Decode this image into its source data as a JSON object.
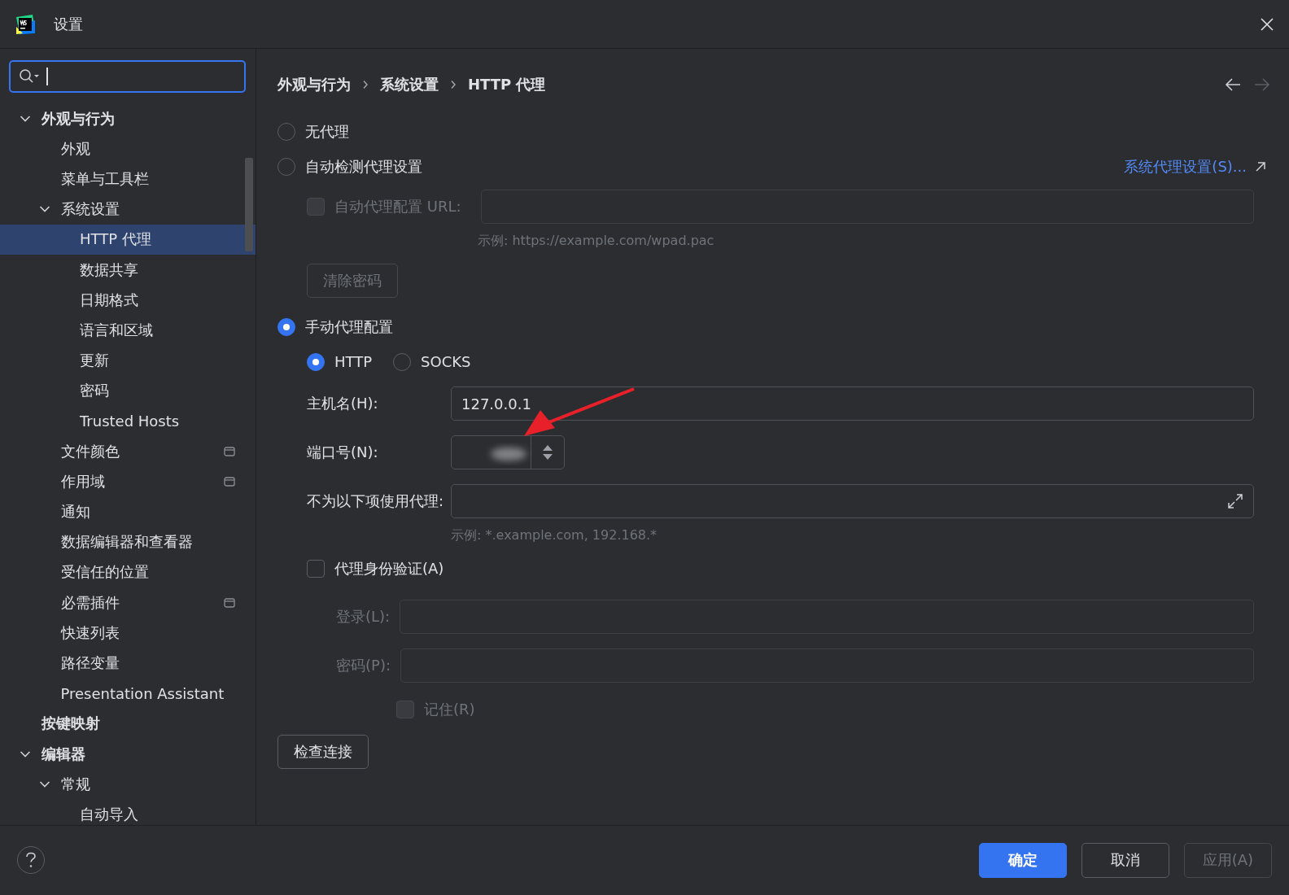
{
  "window": {
    "title": "设置"
  },
  "sidebar": {
    "search": {
      "focused": true
    },
    "tree": [
      {
        "label": "外观与行为",
        "expanded": true,
        "children": [
          {
            "label": "外观"
          },
          {
            "label": "菜单与工具栏"
          },
          {
            "label": "系统设置",
            "expanded": true,
            "children": [
              {
                "label": "HTTP 代理",
                "selected": true
              },
              {
                "label": "数据共享",
                "selected": false
              },
              {
                "label": "日期格式",
                "selected": false
              },
              {
                "label": "语言和区域",
                "selected": false
              },
              {
                "label": "更新",
                "selected": false
              },
              {
                "label": "密码",
                "selected": false
              },
              {
                "label": "Trusted Hosts",
                "selected": false
              }
            ]
          },
          {
            "label": "文件颜色",
            "project_level": true
          },
          {
            "label": "作用域",
            "project_level": true
          },
          {
            "label": "通知"
          },
          {
            "label": "数据编辑器和查看器"
          },
          {
            "label": "受信任的位置"
          },
          {
            "label": "必需插件",
            "project_level": true
          },
          {
            "label": "快速列表"
          },
          {
            "label": "路径变量"
          },
          {
            "label": "Presentation Assistant"
          }
        ]
      },
      {
        "label": "按键映射"
      },
      {
        "label": "编辑器",
        "expanded": true,
        "children": [
          {
            "label": "常规",
            "expanded": true,
            "children": [
              {
                "label": "自动导入",
                "selected": false
              }
            ]
          }
        ]
      }
    ]
  },
  "breadcrumb": [
    "外观与行为",
    "系统设置",
    "HTTP 代理"
  ],
  "proxy": {
    "modes": [
      {
        "label": "无代理",
        "selected": false
      },
      {
        "label": "自动检测代理设置",
        "selected": false
      },
      {
        "label": "手动代理配置",
        "selected": true
      }
    ],
    "system_settings_link": "系统代理设置(S)...",
    "auto_config": {
      "label": "自动代理配置 URL:",
      "checked": false,
      "disabled": true,
      "hint": "示例: https://example.com/wpad.pac"
    },
    "clear_passwords_button": {
      "label": "清除密码",
      "disabled": true
    },
    "protocols": [
      {
        "label": "HTTP",
        "selected": true
      },
      {
        "label": "SOCKS",
        "selected": false
      }
    ],
    "host": {
      "label": "主机名(H):",
      "value": "127.0.0.1"
    },
    "port": {
      "label": "端口号(N):",
      "redacted": true
    },
    "no_proxy": {
      "label": "不为以下项使用代理:",
      "hint": "示例: *.example.com, 192.168.*"
    },
    "auth": {
      "label": "代理身份验证(A)",
      "checked": false
    },
    "login": {
      "label": "登录(L):",
      "disabled": true
    },
    "password": {
      "label": "密码(P):",
      "disabled": true
    },
    "remember": {
      "label": "记住(R)",
      "checked": false,
      "disabled": true
    },
    "check_button": "检查连接"
  },
  "footer": {
    "buttons": [
      {
        "label": "确定",
        "kind": "primary"
      },
      {
        "label": "取消",
        "kind": "normal"
      },
      {
        "label": "应用(A)",
        "kind": "disabled"
      }
    ]
  }
}
